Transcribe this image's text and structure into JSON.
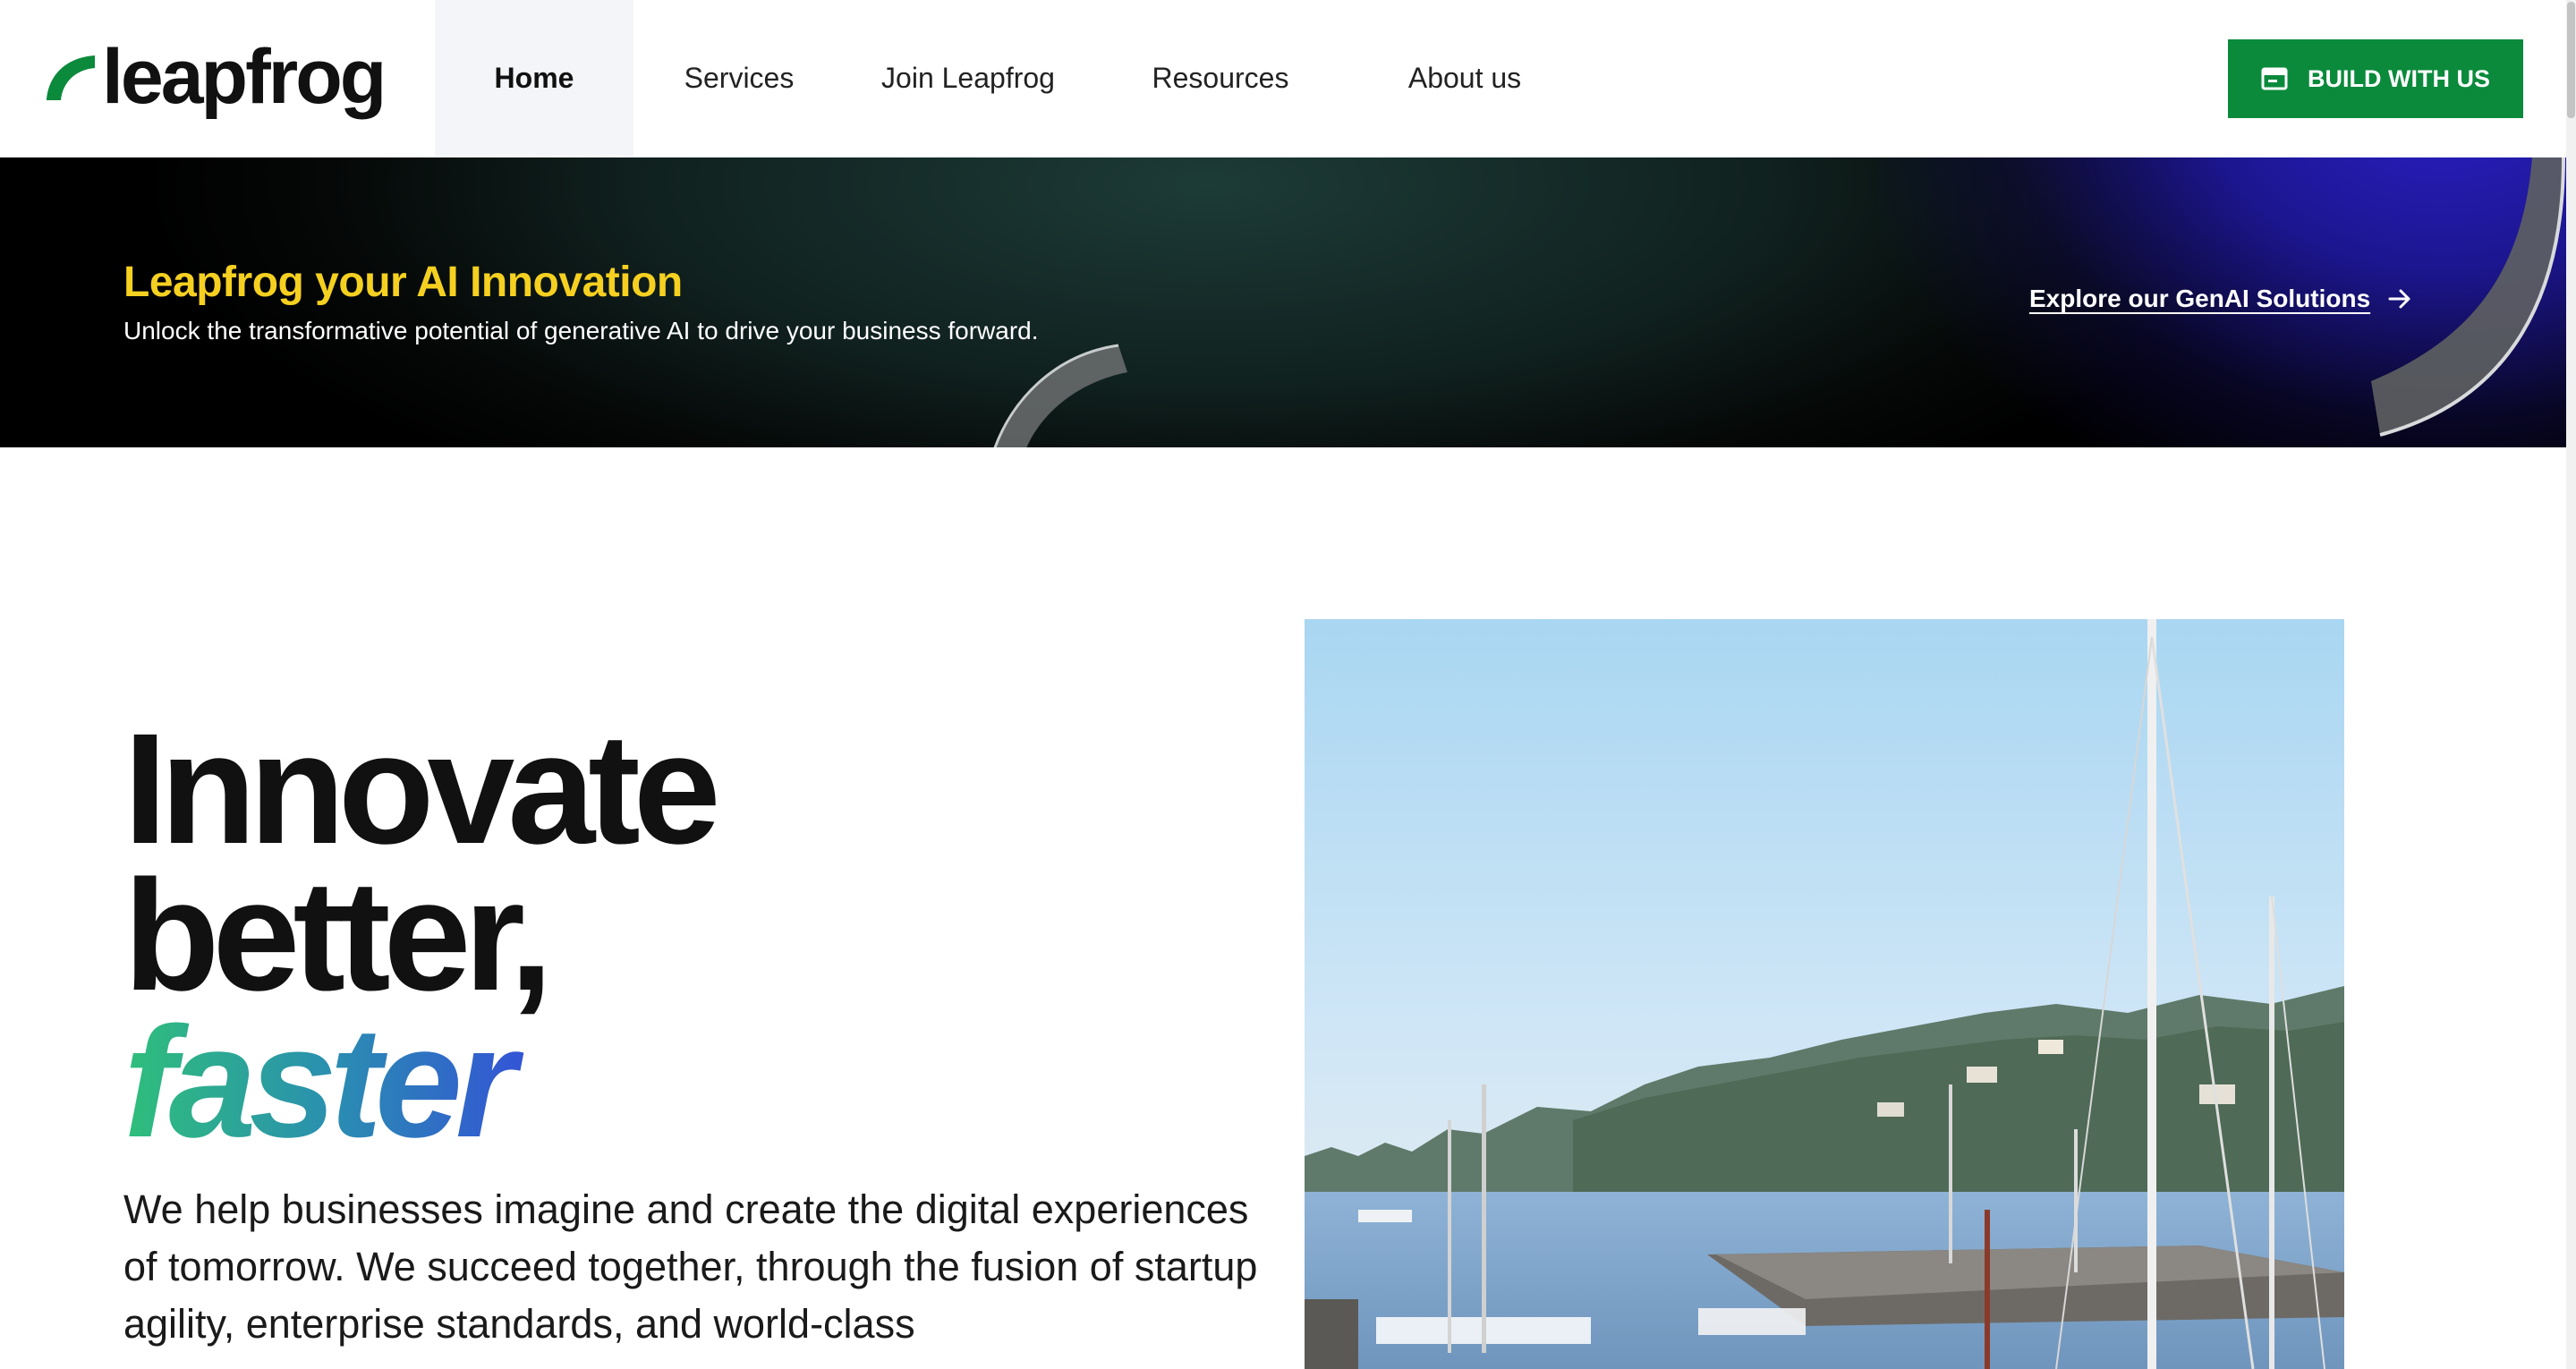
{
  "header": {
    "logo_text": "leapfrog",
    "nav": [
      {
        "label": "Home",
        "active": true
      },
      {
        "label": "Services",
        "active": false
      },
      {
        "label": "Join Leapfrog",
        "active": false
      },
      {
        "label": "Resources",
        "active": false
      },
      {
        "label": "About us",
        "active": false
      }
    ],
    "cta_label": "BUILD WITH US",
    "cta_icon": "browser-window-icon"
  },
  "banner": {
    "title": "Leapfrog your AI Innovation",
    "subtitle": "Unlock the transformative potential of generative AI to drive your business forward.",
    "link_label": "Explore our GenAI Solutions",
    "link_icon": "arrow-right-icon"
  },
  "hero": {
    "title_line1": "Innovate",
    "title_line2": "better,",
    "title_line3": "faster",
    "description": "We help businesses imagine and create the digital experiences of tomorrow. We succeed together, through the fusion of startup agility, enterprise standards, and world-class"
  },
  "colors": {
    "brand_green": "#0b8a3c",
    "banner_title": "#f5d020",
    "gradient_start": "#2fbf7a",
    "gradient_end": "#3a1ff0"
  }
}
